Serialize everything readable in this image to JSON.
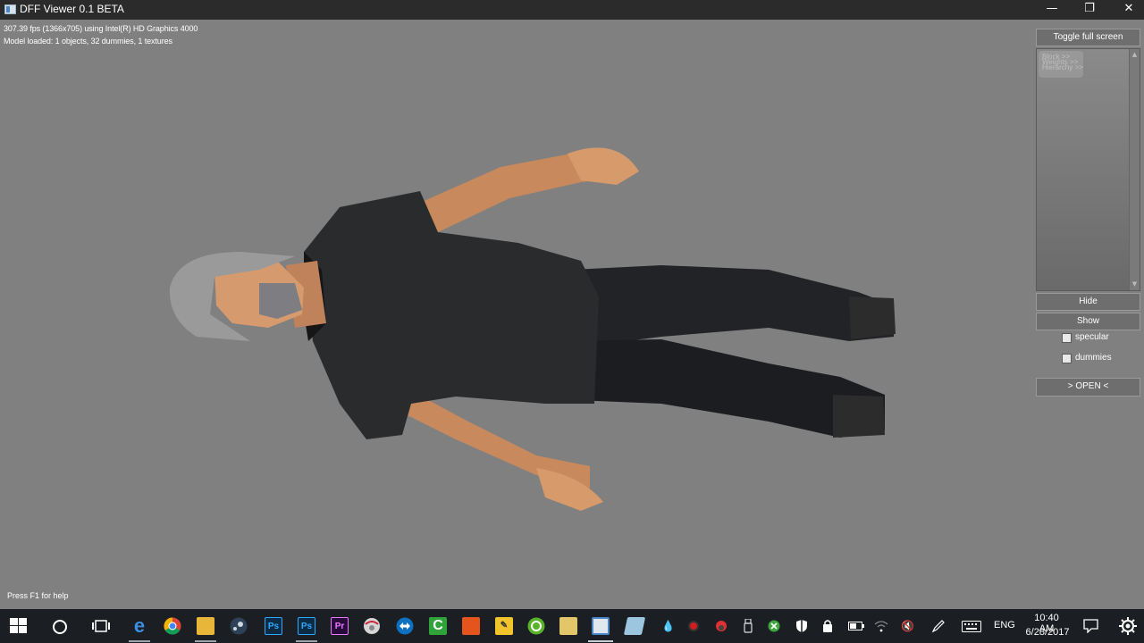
{
  "window": {
    "title": "DFF Viewer 0.1 BETA",
    "min_glyph": "—",
    "restore_glyph": "❐",
    "close_glyph": "✕"
  },
  "viewport": {
    "fps_text": "307.39 fps (1366x705) using Intel(R) HD Graphics 4000",
    "model_text": "Model loaded: 1 objects, 32 dummies, 1 textures",
    "help_text": "Press F1 for help"
  },
  "panel": {
    "toggle_fullscreen": "Toggle full screen",
    "hide": "Hide",
    "show": "Show",
    "specular": "specular",
    "dummies": "dummies",
    "open": "> OPEN <",
    "list_items": [
      "Block >>",
      "Weights >>",
      "Hierarchy >>"
    ]
  },
  "taskbar": {
    "apps": [
      {
        "name": "start",
        "icon": "windows-logo-icon"
      },
      {
        "name": "search",
        "icon": "cortana-circle-icon"
      },
      {
        "name": "task-view",
        "icon": "task-view-icon"
      },
      {
        "name": "edge",
        "icon": "edge-icon",
        "label": "e",
        "color": "#1e78d6"
      },
      {
        "name": "chrome",
        "icon": "chrome-icon",
        "color": "#e8b000"
      },
      {
        "name": "file-explorer",
        "icon": "folder-icon",
        "color": "#f0c24a"
      },
      {
        "name": "steam",
        "icon": "steam-icon",
        "color": "#3a4e63"
      },
      {
        "name": "photoshop",
        "icon": "photoshop-icon",
        "label": "Ps",
        "color": "#0c2b44"
      },
      {
        "name": "photoshop-2",
        "icon": "photoshop-icon",
        "label": "Ps",
        "color": "#0c2b44"
      },
      {
        "name": "premiere",
        "icon": "premiere-icon",
        "label": "Pr",
        "color": "#2a0a3a"
      },
      {
        "name": "globe-app",
        "icon": "globe-icon",
        "color": "#c9c9c9"
      },
      {
        "name": "teamviewer",
        "icon": "teamviewer-icon",
        "color": "#0e70c0"
      },
      {
        "name": "camtasia",
        "icon": "camtasia-icon",
        "label": "C",
        "color": "#2fa33a"
      },
      {
        "name": "orange-app",
        "icon": "orange-app-icon",
        "color": "#e5541d"
      },
      {
        "name": "notes",
        "icon": "pencil-icon",
        "color": "#f2c42c"
      },
      {
        "name": "green-circle",
        "icon": "refresh-circle-icon",
        "color": "#59b32a"
      },
      {
        "name": "image-viewer",
        "icon": "picture-icon",
        "color": "#e3c56a"
      },
      {
        "name": "dff-viewer",
        "icon": "dff-viewer-icon",
        "color": "#dfe7ef"
      },
      {
        "name": "crystal-app",
        "icon": "crystal-icon",
        "color": "#9cc6e0"
      }
    ],
    "tray_lang": "ENG",
    "time": "10:40 AM",
    "date": "6/28/2017",
    "tray_icons": [
      "drop-icon",
      "record-icon",
      "red-shield-icon",
      "usb-icon",
      "green-x-icon",
      "defender-icon",
      "lock-icon",
      "battery-icon",
      "wifi-icon",
      "volume-muted-icon",
      "pen-icon",
      "keyboard-icon"
    ]
  }
}
